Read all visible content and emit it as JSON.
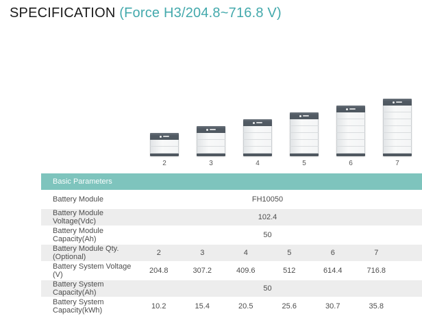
{
  "header": {
    "title": "SPECIFICATION",
    "model": "(Force H3/204.8~716.8 V)"
  },
  "illustration": {
    "stacks": [
      {
        "label": "2",
        "modules": 2
      },
      {
        "label": "3",
        "modules": 3
      },
      {
        "label": "4",
        "modules": 4
      },
      {
        "label": "5",
        "modules": 5
      },
      {
        "label": "6",
        "modules": 6
      },
      {
        "label": "7",
        "modules": 7
      }
    ]
  },
  "table": {
    "section_header": "Basic Parameters",
    "rows": [
      {
        "label": "Battery Module",
        "span_value": "FH10050"
      },
      {
        "label": "Battery Module Voltage(Vdc)",
        "span_value": "102.4"
      },
      {
        "label": "Battery Module Capacity(Ah)",
        "span_value": "50"
      },
      {
        "label": "Battery Module Qty. (Optional)",
        "values": [
          "2",
          "3",
          "4",
          "5",
          "6",
          "7"
        ]
      },
      {
        "label": "Battery System Voltage (V)",
        "values": [
          "204.8",
          "307.2",
          "409.6",
          "512",
          "614.4",
          "716.8"
        ]
      },
      {
        "label": "Battery System Capacity(Ah)",
        "span_value": "50"
      },
      {
        "label": "Battery System Capacity(kWh)",
        "values": [
          "10.2",
          "15.4",
          "20.5",
          "25.6",
          "30.7",
          "35.8"
        ]
      }
    ]
  },
  "colors": {
    "header_teal": "#7ec4bd",
    "title_accent": "#43a9ac",
    "row_alt": "#ededed",
    "battery_dark": "#4f5860",
    "text": "#4c4c4c"
  }
}
